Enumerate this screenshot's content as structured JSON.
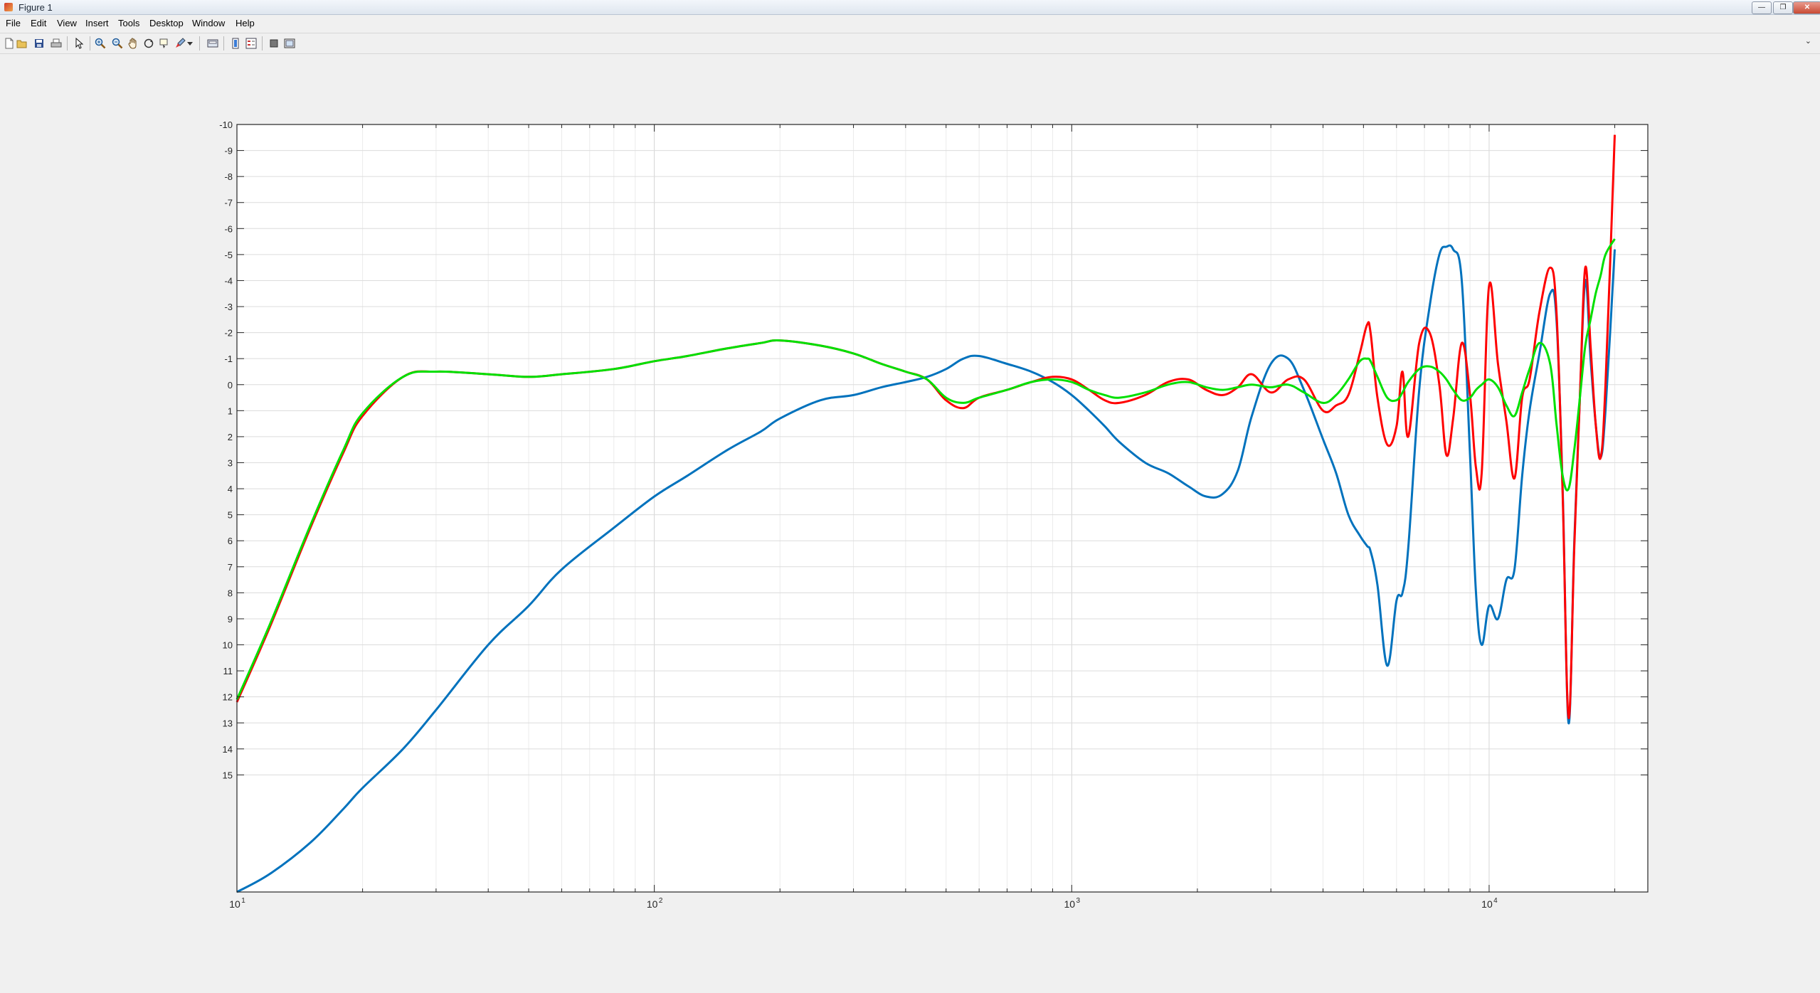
{
  "window": {
    "title": "Figure 1",
    "controls": [
      "minimize",
      "restore",
      "close"
    ]
  },
  "menu": [
    "File",
    "Edit",
    "View",
    "Insert",
    "Tools",
    "Desktop",
    "Window",
    "Help"
  ],
  "toolbar": {
    "icons": [
      "new-figure-icon",
      "open-file-icon",
      "save-icon",
      "print-icon",
      "select-arrow-icon",
      "zoom-in-icon",
      "zoom-out-icon",
      "pan-hand-icon",
      "rotate-3d-icon",
      "data-cursor-icon",
      "brush-icon",
      "brush-dropdown-icon",
      "link-plot-icon",
      "colorbar-icon",
      "legend-icon",
      "hide-plot-tools-icon",
      "show-plot-tools-icon"
    ],
    "dock_arrow": "⌄"
  },
  "chart_data": {
    "type": "line",
    "xscale": "log",
    "xlim": [
      10,
      24000
    ],
    "ylim": [
      15,
      -10
    ],
    "ylim_extended": [
      19.5,
      -10
    ],
    "yreversed": true,
    "y_ticks": [
      -10,
      -9,
      -8,
      -7,
      -6,
      -5,
      -4,
      -3,
      -2,
      -1,
      0,
      1,
      2,
      3,
      4,
      5,
      6,
      7,
      8,
      9,
      10,
      11,
      12,
      13,
      14,
      15
    ],
    "y_tick_labels": [
      "-10",
      "-9",
      "-8",
      "-7",
      "-6",
      "-5",
      "-4",
      "-3",
      "-2",
      "-1",
      "0",
      "1",
      "2",
      "3",
      "4",
      "5",
      "6",
      "7",
      "8",
      "9",
      "10",
      "11",
      "12",
      "13",
      "14",
      "15"
    ],
    "x_ticks": [
      10,
      100,
      1000,
      10000
    ],
    "x_tick_labels": [
      {
        "base": "10",
        "exp": "1"
      },
      {
        "base": "10",
        "exp": "2"
      },
      {
        "base": "10",
        "exp": "3"
      },
      {
        "base": "10",
        "exp": "4"
      }
    ],
    "grid": true,
    "minor_grid_x": true,
    "series": [
      {
        "color": "#0072BD",
        "x": [
          10,
          12,
          15,
          18,
          20,
          25,
          30,
          40,
          50,
          60,
          80,
          100,
          120,
          150,
          180,
          200,
          250,
          300,
          350,
          400,
          450,
          500,
          550,
          600,
          700,
          800,
          900,
          1000,
          1100,
          1200,
          1300,
          1500,
          1700,
          1900,
          2100,
          2300,
          2500,
          2700,
          3000,
          3300,
          3600,
          4000,
          4300,
          4600,
          4900,
          5100,
          5200,
          5400,
          5700,
          6000,
          6200,
          6400,
          6800,
          7200,
          7600,
          7900,
          8200,
          8600,
          9000,
          9300,
          9600,
          10000,
          10500,
          11000,
          11500,
          12000,
          12500,
          13200,
          14000,
          14500,
          15000,
          15500,
          16000,
          16500,
          17000,
          17500,
          18000,
          18500,
          19000,
          20000
        ],
        "y": [
          19.5,
          18.8,
          17.6,
          16.3,
          15.5,
          14.0,
          12.5,
          10.0,
          8.5,
          7.1,
          5.5,
          4.3,
          3.5,
          2.5,
          1.8,
          1.3,
          0.6,
          0.4,
          0.1,
          -0.1,
          -0.3,
          -0.6,
          -1.0,
          -1.1,
          -0.8,
          -0.5,
          -0.1,
          0.4,
          1.0,
          1.6,
          2.2,
          3.0,
          3.4,
          3.9,
          4.3,
          4.2,
          3.3,
          1.2,
          -0.8,
          -1.0,
          0.2,
          2.1,
          3.4,
          5.0,
          5.8,
          6.2,
          6.4,
          7.7,
          10.8,
          8.3,
          8.0,
          6.3,
          0.2,
          -3.0,
          -5.0,
          -5.3,
          -5.2,
          -4.0,
          2.7,
          8.0,
          10.0,
          8.5,
          9.0,
          7.5,
          7.1,
          3.5,
          1.0,
          -1.2,
          -3.5,
          -2.5,
          4.0,
          13.0,
          6.0,
          0.5,
          -4.0,
          -1.0,
          1.5,
          2.8,
          1.0,
          -5.2
        ]
      },
      {
        "color": "#FF0000",
        "x": [
          10,
          12,
          15,
          18,
          20,
          25,
          30,
          40,
          50,
          60,
          80,
          100,
          120,
          150,
          180,
          200,
          250,
          300,
          350,
          400,
          450,
          500,
          550,
          600,
          700,
          800,
          900,
          1000,
          1100,
          1200,
          1300,
          1500,
          1700,
          1900,
          2100,
          2300,
          2500,
          2700,
          3000,
          3300,
          3600,
          4000,
          4300,
          4600,
          4900,
          5100,
          5200,
          5400,
          5700,
          6000,
          6200,
          6400,
          6800,
          7200,
          7600,
          7900,
          8200,
          8600,
          9000,
          9300,
          9600,
          10000,
          10500,
          11000,
          11500,
          12000,
          12500,
          13200,
          14000,
          14500,
          15000,
          15500,
          16000,
          16500,
          17000,
          17500,
          18000,
          18500,
          19000,
          20000
        ],
        "y": [
          12.2,
          9.3,
          5.5,
          2.6,
          1.2,
          -0.3,
          -0.5,
          -0.4,
          -0.3,
          -0.4,
          -0.6,
          -0.9,
          -1.1,
          -1.4,
          -1.6,
          -1.7,
          -1.5,
          -1.2,
          -0.8,
          -0.5,
          -0.2,
          0.6,
          0.9,
          0.5,
          0.2,
          -0.1,
          -0.3,
          -0.2,
          0.2,
          0.6,
          0.7,
          0.4,
          -0.1,
          -0.2,
          0.2,
          0.4,
          0.1,
          -0.4,
          0.3,
          -0.2,
          -0.2,
          1.0,
          0.8,
          0.4,
          -1.2,
          -2.3,
          -2.0,
          0.5,
          2.3,
          1.6,
          -0.5,
          2.0,
          -1.6,
          -2.0,
          0.0,
          2.7,
          1.3,
          -1.6,
          0.4,
          3.2,
          3.4,
          -3.8,
          -0.8,
          1.4,
          3.6,
          0.5,
          -0.2,
          -2.8,
          -4.5,
          -2.8,
          4.2,
          12.8,
          6.2,
          0.5,
          -4.5,
          -1.5,
          1.5,
          2.8,
          0.0,
          -9.6
        ]
      },
      {
        "color": "#00E000",
        "x": [
          10,
          12,
          15,
          18,
          20,
          25,
          30,
          40,
          50,
          60,
          80,
          100,
          120,
          150,
          180,
          200,
          250,
          300,
          350,
          400,
          450,
          500,
          550,
          600,
          700,
          800,
          900,
          1000,
          1100,
          1200,
          1300,
          1500,
          1700,
          1900,
          2100,
          2300,
          2500,
          2700,
          3000,
          3300,
          3600,
          4000,
          4300,
          4600,
          4900,
          5100,
          5200,
          5400,
          5700,
          6000,
          6200,
          6400,
          6800,
          7200,
          7600,
          7900,
          8200,
          8600,
          9000,
          9300,
          9600,
          10000,
          10500,
          11000,
          11500,
          12000,
          12500,
          13200,
          14000,
          14500,
          15000,
          15500,
          16000,
          16500,
          17000,
          17500,
          18000,
          18500,
          19000,
          20000
        ],
        "y": [
          12.1,
          9.2,
          5.4,
          2.5,
          1.1,
          -0.3,
          -0.5,
          -0.4,
          -0.3,
          -0.4,
          -0.6,
          -0.9,
          -1.1,
          -1.4,
          -1.6,
          -1.7,
          -1.5,
          -1.2,
          -0.8,
          -0.5,
          -0.2,
          0.5,
          0.7,
          0.5,
          0.2,
          -0.1,
          -0.2,
          -0.1,
          0.2,
          0.4,
          0.5,
          0.3,
          0.0,
          -0.1,
          0.1,
          0.2,
          0.1,
          0.0,
          0.1,
          0.0,
          0.3,
          0.7,
          0.4,
          -0.2,
          -0.9,
          -1.0,
          -0.9,
          -0.3,
          0.5,
          0.6,
          0.3,
          -0.1,
          -0.6,
          -0.7,
          -0.5,
          -0.2,
          0.2,
          0.6,
          0.5,
          0.2,
          0.0,
          -0.2,
          0.1,
          0.8,
          1.2,
          0.3,
          -0.6,
          -1.6,
          -0.8,
          1.5,
          3.5,
          4.0,
          2.5,
          0.5,
          -1.5,
          -2.5,
          -3.5,
          -4.2,
          -5.0,
          -5.6
        ]
      }
    ]
  }
}
